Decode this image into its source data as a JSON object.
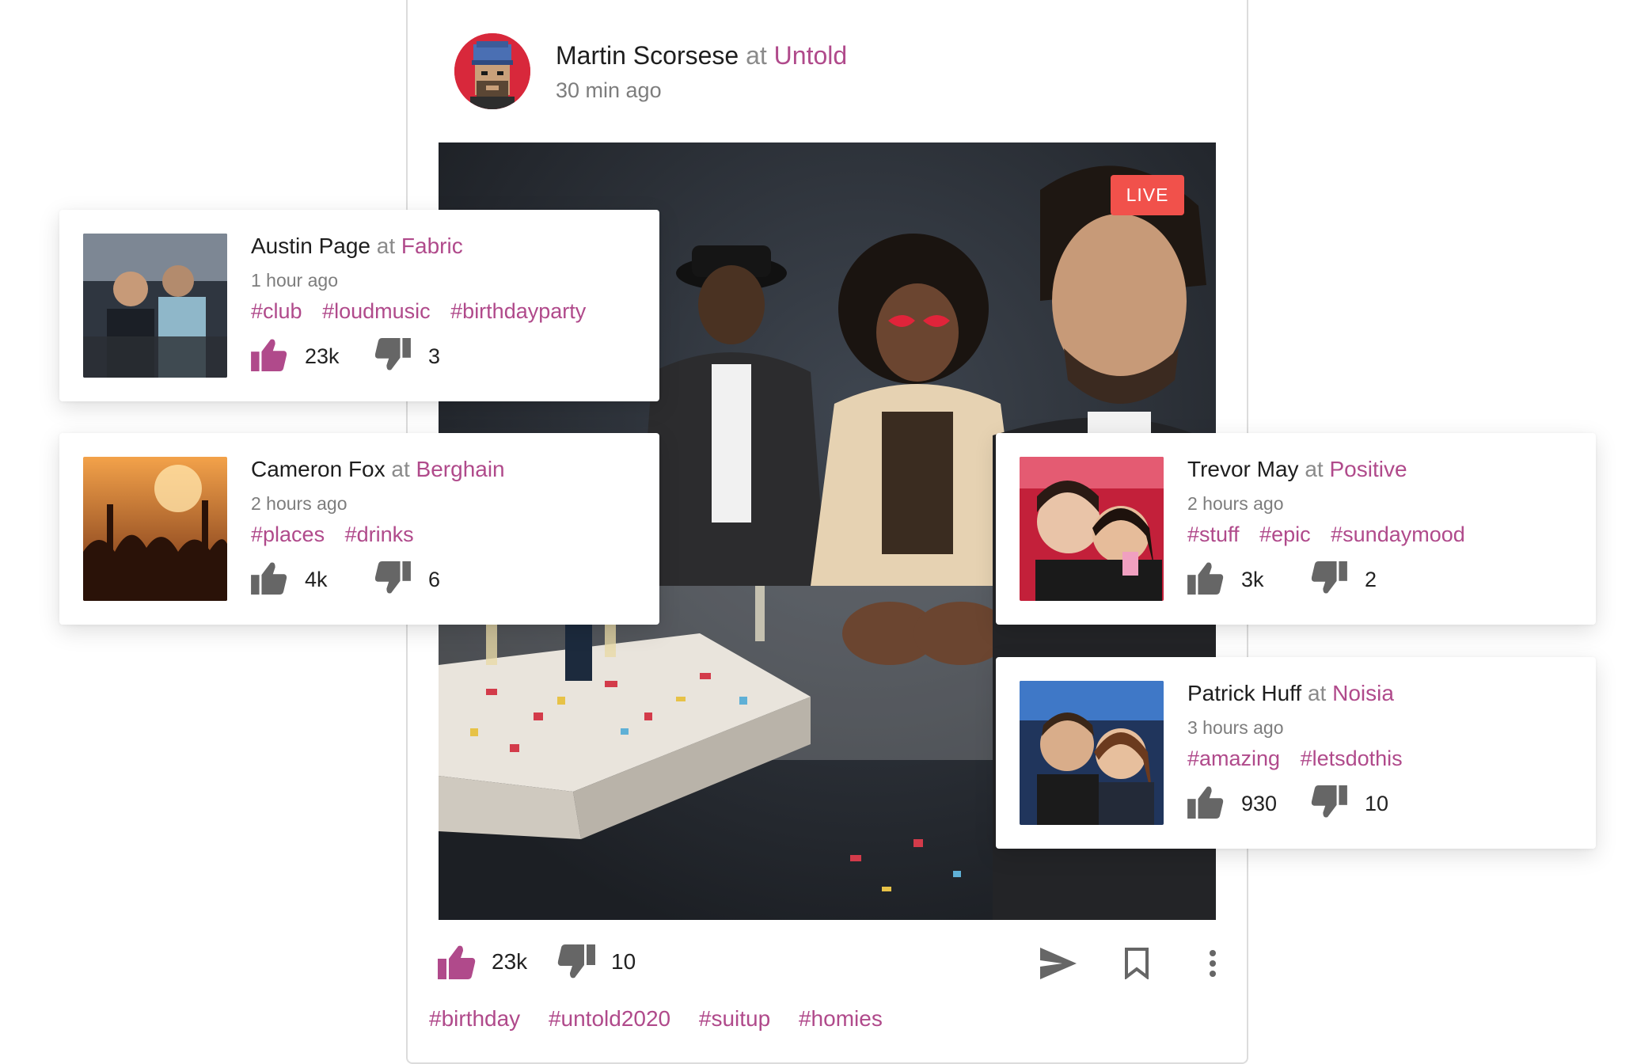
{
  "colors": {
    "accent": "#b04a8b",
    "live": "#f1514b",
    "icon": "#666666",
    "like_active": "#b04a8b"
  },
  "main_post": {
    "author": "Martin Scorsese",
    "at": "at",
    "venue": "Untold",
    "time": "30 min ago",
    "live_label": "LIVE",
    "likes": "23k",
    "dislikes": "10",
    "tags": [
      "#birthday",
      "#untold2020",
      "#suitup",
      "#homies"
    ]
  },
  "feed": [
    {
      "author": "Austin Page",
      "at": "at",
      "venue": "Fabric",
      "time": "1 hour ago",
      "tags": [
        "#club",
        "#loudmusic",
        "#birthdayparty"
      ],
      "likes": "23k",
      "dislikes": "3",
      "liked": true
    },
    {
      "author": "Cameron Fox",
      "at": "at",
      "venue": "Berghain",
      "time": "2 hours ago",
      "tags": [
        "#places",
        "#drinks"
      ],
      "likes": "4k",
      "dislikes": "6",
      "liked": false
    },
    {
      "author": "Trevor May",
      "at": "at",
      "venue": "Positive",
      "time": "2 hours ago",
      "tags": [
        "#stuff",
        "#epic",
        "#sundaymood"
      ],
      "likes": "3k",
      "dislikes": "2",
      "liked": false
    },
    {
      "author": "Patrick Huff",
      "at": "at",
      "venue": "Noisia",
      "time": "3 hours ago",
      "tags": [
        "#amazing",
        "#letsdothis"
      ],
      "likes": "930",
      "dislikes": "10",
      "liked": false
    }
  ],
  "icons": [
    "thumbs-up-icon",
    "thumbs-down-icon",
    "send-icon",
    "bookmark-icon",
    "more-vertical-icon"
  ]
}
